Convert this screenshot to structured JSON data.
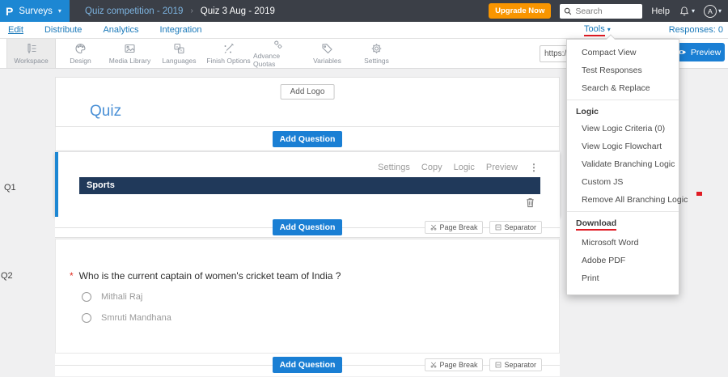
{
  "topbar": {
    "logo_letter": "P",
    "product": "Surveys",
    "breadcrumb_parent": "Quiz competition - 2019",
    "breadcrumb_current": "Quiz 3 Aug - 2019",
    "upgrade_label": "Upgrade Now",
    "search_placeholder": "Search",
    "help_label": "Help",
    "avatar_letter": "A"
  },
  "navbar": {
    "items": [
      "Edit",
      "Distribute",
      "Analytics",
      "Integration"
    ],
    "tools_label": "Tools",
    "responses_label": "Responses: 0"
  },
  "toolbar": {
    "items": [
      "Workspace",
      "Design",
      "Media Library",
      "Languages",
      "Finish Options",
      "Advance Quotas",
      "Variables",
      "Settings"
    ],
    "url_value": "https://",
    "preview_label": "Preview"
  },
  "tools_menu": {
    "items_top": [
      "Compact View",
      "Test Responses",
      "Search & Replace"
    ],
    "logic_header": "Logic",
    "logic_items": [
      "View Logic Criteria (0)",
      "View Logic Flowchart",
      "Validate Branching Logic",
      "Custom JS",
      "Remove All Branching Logic"
    ],
    "download_header": "Download",
    "download_items": [
      "Microsoft Word",
      "Adobe PDF",
      "Print"
    ]
  },
  "editor": {
    "add_logo_label": "Add Logo",
    "survey_title": "Quiz",
    "add_question_label": "Add Question",
    "page_break_label": "Page Break",
    "separator_label": "Separator",
    "q1": {
      "label": "Q1",
      "actions": [
        "Settings",
        "Copy",
        "Logic",
        "Preview"
      ],
      "section_title": "Sports"
    },
    "q2": {
      "label": "Q2",
      "required_marker": "*",
      "question": "Who is the current captain of women's cricket team of India ?",
      "options": [
        "Mithali Raj",
        "Smruti Mandhana"
      ]
    }
  },
  "colors": {
    "topbar_dark": "#3b3f47",
    "brand_blue": "#1d87d3",
    "nav_blue": "#1878b9",
    "accent_orange": "#f99500",
    "button_blue": "#1a7fd4",
    "section_bar_navy": "#20395a",
    "title_blue": "#4a90d6",
    "annotation_red": "#e01b24"
  }
}
